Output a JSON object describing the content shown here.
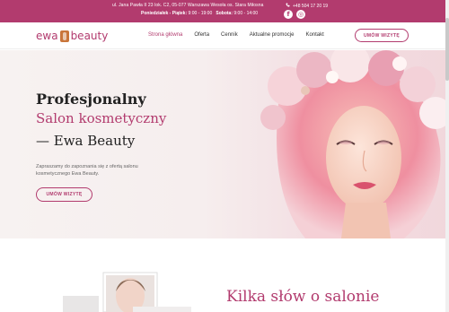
{
  "topbar": {
    "address": "ul. Jana Pawła II 23 lok. C2, 05-077 Warszawa Wesoła os. Stara Miłosna",
    "hours_label_weekdays": "Poniedziałek - Piątek:",
    "hours_weekdays": "9:00 - 19:00",
    "hours_label_saturday": "Sobota:",
    "hours_saturday": "9:00 - 14:00",
    "phone": "+48 504 17 20 19",
    "social": [
      {
        "icon": "facebook-icon",
        "glyph": "f"
      },
      {
        "icon": "instagram-icon",
        "glyph": "◎"
      }
    ]
  },
  "logo": {
    "left": "ewa",
    "right": "beauty"
  },
  "nav": {
    "items": [
      {
        "label": "Strona główna",
        "active": true
      },
      {
        "label": "Oferta",
        "active": false
      },
      {
        "label": "Cennik",
        "active": false
      },
      {
        "label": "Aktualne promocje",
        "active": false
      },
      {
        "label": "Kontakt",
        "active": false
      }
    ],
    "cta": "UMÓW WIZYTĘ"
  },
  "hero": {
    "line1": "Profesjonalny",
    "line2": "Salon kosmetyczny",
    "line3": "— Ewa Beauty",
    "description": "Zapraszamy do zapoznania się z ofertą salonu kosmetycznego Ewa Beauty.",
    "cta": "UMÓW WIZYTĘ"
  },
  "about": {
    "title": "Kilka słów o salonie"
  },
  "colors": {
    "accent": "#b23b6e",
    "logo_mark": "#c9753a"
  }
}
